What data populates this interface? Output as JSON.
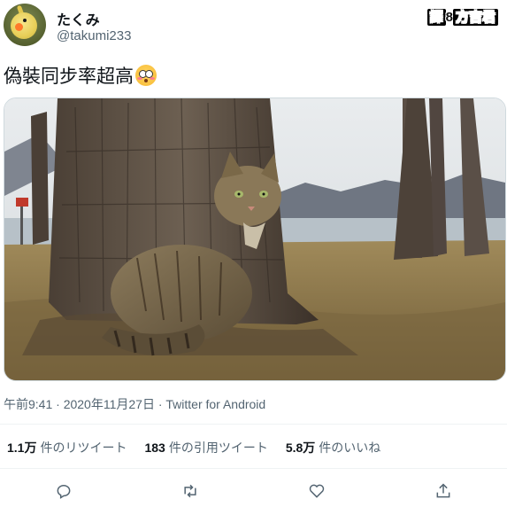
{
  "user": {
    "display_name": "たくみ",
    "handle": "@takumi233",
    "avatar_icon": "cockatiel-avatar"
  },
  "watermark": {
    "text_pre": "譯",
    "text_sep": "8",
    "text_post": "方吉君"
  },
  "tweet": {
    "text": "偽裝同步率超高",
    "emoji": "flushed-face-emoji"
  },
  "photo": {
    "description_icon": "cat-by-tree-photo"
  },
  "meta": {
    "timestamp": "午前9:41 · 2020年11月27日 · Twitter for Android"
  },
  "stats": {
    "retweets_count": "1.1万",
    "retweets_label": "件のリツイート",
    "quotes_count": "183",
    "quotes_label": "件の引用ツイート",
    "likes_count": "5.8万",
    "likes_label": "件のいいね"
  },
  "actions": {
    "reply_icon": "reply-icon",
    "retweet_icon": "retweet-icon",
    "like_icon": "heart-icon",
    "share_icon": "share-icon"
  },
  "colors": {
    "text_primary": "#0f1419",
    "text_secondary": "#536471",
    "divider": "#eff3f4"
  }
}
